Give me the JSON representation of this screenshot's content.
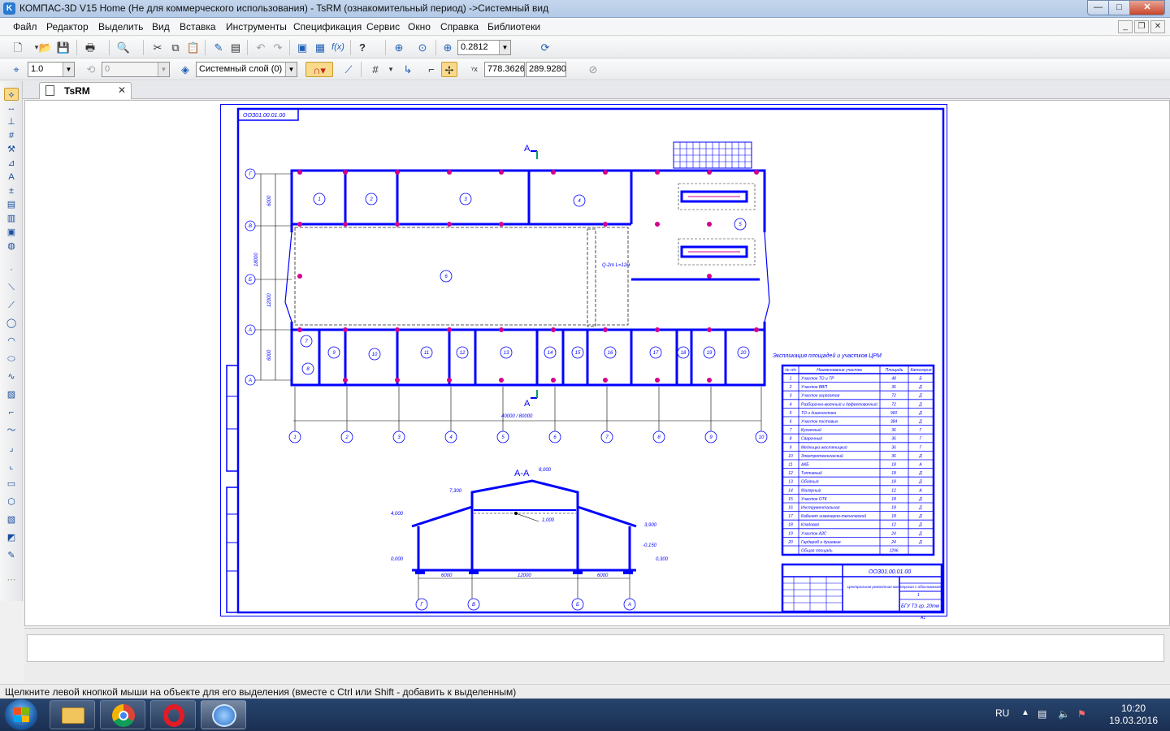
{
  "window": {
    "app_icon": "kompas-k-icon",
    "title": "КОМПАС-3D V15 Home (Не для коммерческого использования) - TsRM (ознакомительный период) ->Системный вид",
    "btn_minimize": "—",
    "btn_maximize": "□",
    "btn_close": "✕"
  },
  "menu": {
    "items": [
      "Файл",
      "Редактор",
      "Выделить",
      "Вид",
      "Вставка",
      "Инструменты",
      "Спецификация",
      "Сервис",
      "Окно",
      "Справка",
      "Библиотеки"
    ]
  },
  "toolbar1": {
    "zoom_value": "0.2812"
  },
  "toolbar2": {
    "line_scale": "1.0",
    "angle": "0",
    "layer": "Системный слой (0)",
    "coord_x": "778.3626",
    "coord_y": "289.9280"
  },
  "document_tab": {
    "label": "TsRM",
    "close": "✕"
  },
  "drawing": {
    "stamp_tl": "ООЗ01.00.01.00",
    "section_mark": "А",
    "section_title": "А-А",
    "overall_length": "40000 / 80000",
    "table_title": "Экспликация площадей и участков ЦРМ",
    "table_headers": [
      "№ п/п",
      "Наименование участка",
      "Площадь",
      "Категория"
    ],
    "table_rows": [
      [
        "1",
        "Участок ТО и ТР",
        "48",
        "Б"
      ],
      [
        "2",
        "Участок ВВП",
        "36",
        "Д"
      ],
      [
        "3",
        "Участок агрегатов",
        "72",
        "Д"
      ],
      [
        "4",
        "Разборочно-моечный и дефектовочный",
        "72",
        "Д"
      ],
      [
        "5",
        "ТО и диагностики",
        "960",
        "Д"
      ],
      [
        "6",
        "Участок постовых",
        "384",
        "Д"
      ],
      [
        "7",
        "Кузнечный",
        "36",
        "Г"
      ],
      [
        "8",
        "Сварочный",
        "36",
        "Г"
      ],
      [
        "9",
        "Медницко-жестяницкий",
        "36",
        "Г"
      ],
      [
        "10",
        "Электротехнический",
        "36",
        "Д"
      ],
      [
        "11",
        "АКБ",
        "18",
        "А"
      ],
      [
        "12",
        "Топливный",
        "18",
        "Д"
      ],
      [
        "13",
        "Обойный",
        "18",
        "Д"
      ],
      [
        "14",
        "Малярный",
        "12",
        "А"
      ],
      [
        "15",
        "Участок ОТК",
        "18",
        "Д"
      ],
      [
        "16",
        "Инструментальная",
        "18",
        "Д"
      ],
      [
        "17",
        "Кабинет инженерно-технический",
        "18",
        "Д"
      ],
      [
        "18",
        "Кладовая",
        "12",
        "Д"
      ],
      [
        "19",
        "Участок АЗС",
        "24",
        "Д"
      ],
      [
        "20",
        "Гардероб и душевые",
        "24",
        "Д"
      ],
      [
        "",
        "Общая площадь",
        "1296",
        ""
      ]
    ],
    "title_block_code": "ООЗ01.00.01.00",
    "title_block_name": "Центральная ремонтная мастерская с обоснованием",
    "title_block_org": "БГУ ТЗ гр. 20тм",
    "title_block_sheet": "1",
    "title_block_format": "А1",
    "axes_bottom": [
      "1",
      "2",
      "3",
      "4",
      "5",
      "6",
      "7",
      "8",
      "9",
      "10"
    ],
    "axes_left": [
      "Г",
      "В",
      "Б",
      "А",
      "А"
    ],
    "axes_section": [
      "Г",
      "В",
      "Б",
      "А"
    ],
    "dims_left": [
      "6000",
      "18000",
      "12000",
      "6000"
    ],
    "section_elevations": [
      "8,000",
      "7,300",
      "4,000",
      "3,900",
      "0,000",
      "-0,150",
      "0,300",
      "1,000"
    ],
    "section_dims": [
      "6000",
      "12000",
      "6000"
    ],
    "crane_note": "Q-2т\nL=12м",
    "room_numbers": [
      "1",
      "2",
      "3",
      "4",
      "5",
      "6",
      "7",
      "8",
      "9",
      "10",
      "11",
      "12",
      "13",
      "14",
      "15",
      "16",
      "17",
      "18",
      "19",
      "20"
    ]
  },
  "status": {
    "message": "Щелкните левой кнопкой мыши на объекте для его выделения (вместе с Ctrl или Shift - добавить к выделенным)"
  },
  "taskbar": {
    "language": "RU",
    "time": "10:20",
    "date": "19.03.2016"
  },
  "colors": {
    "drawing_blue": "#0000ff",
    "column_magenta": "#d4008c",
    "accent_green": "#00a060"
  }
}
